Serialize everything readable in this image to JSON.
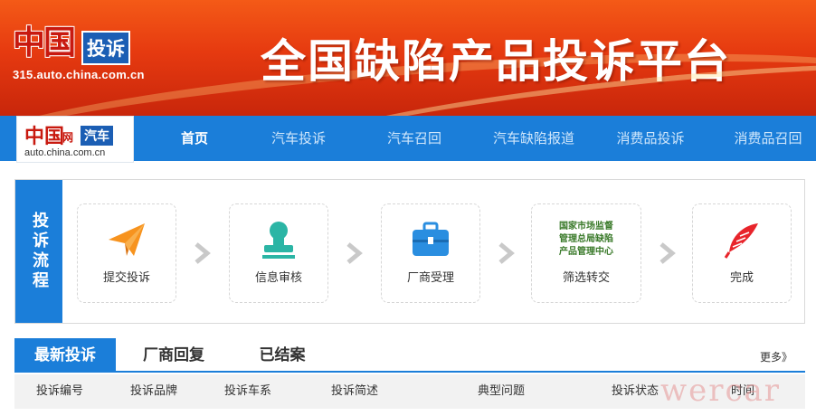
{
  "banner": {
    "logo_china": "中国",
    "logo_tousu": "投诉",
    "logo_url": "315.auto.china.com.cn",
    "title": "全国缺陷产品投诉平台"
  },
  "nav": {
    "logo": {
      "china": "中国",
      "net": "网",
      "qiche": "汽车",
      "url": "auto.china.com.cn"
    },
    "items": [
      {
        "label": "首页",
        "active": true
      },
      {
        "label": "汽车投诉"
      },
      {
        "label": "汽车召回"
      },
      {
        "label": "汽车缺陷报道"
      },
      {
        "label": "消费品投诉"
      },
      {
        "label": "消费品召回"
      }
    ]
  },
  "process": {
    "label": "投诉流程",
    "steps": [
      {
        "label": "提交投诉",
        "icon": "paper-plane-icon",
        "color": "#f7931e"
      },
      {
        "label": "信息审核",
        "icon": "stamp-icon",
        "color": "#2bb5a5"
      },
      {
        "label": "厂商受理",
        "icon": "briefcase-icon",
        "color": "#2a8ee0"
      },
      {
        "label": "筛选转交",
        "icon": "agency-text",
        "agency_lines": [
          "国家市场监督",
          "管理总局缺陷",
          "产品管理中心"
        ]
      },
      {
        "label": "完成",
        "icon": "feather-icon",
        "color": "#e8242b"
      }
    ]
  },
  "tabs": {
    "items": [
      {
        "label": "最新投诉",
        "active": true
      },
      {
        "label": "厂商回复"
      },
      {
        "label": "已结案"
      }
    ],
    "more": "更多》"
  },
  "table": {
    "headers": [
      "投诉编号",
      "投诉品牌",
      "投诉车系",
      "投诉简述",
      "典型问题",
      "投诉状态",
      "时间"
    ]
  },
  "watermark": "wercar",
  "colors": {
    "brand_blue": "#1b7ed9",
    "banner_orange": "#e63a10"
  }
}
